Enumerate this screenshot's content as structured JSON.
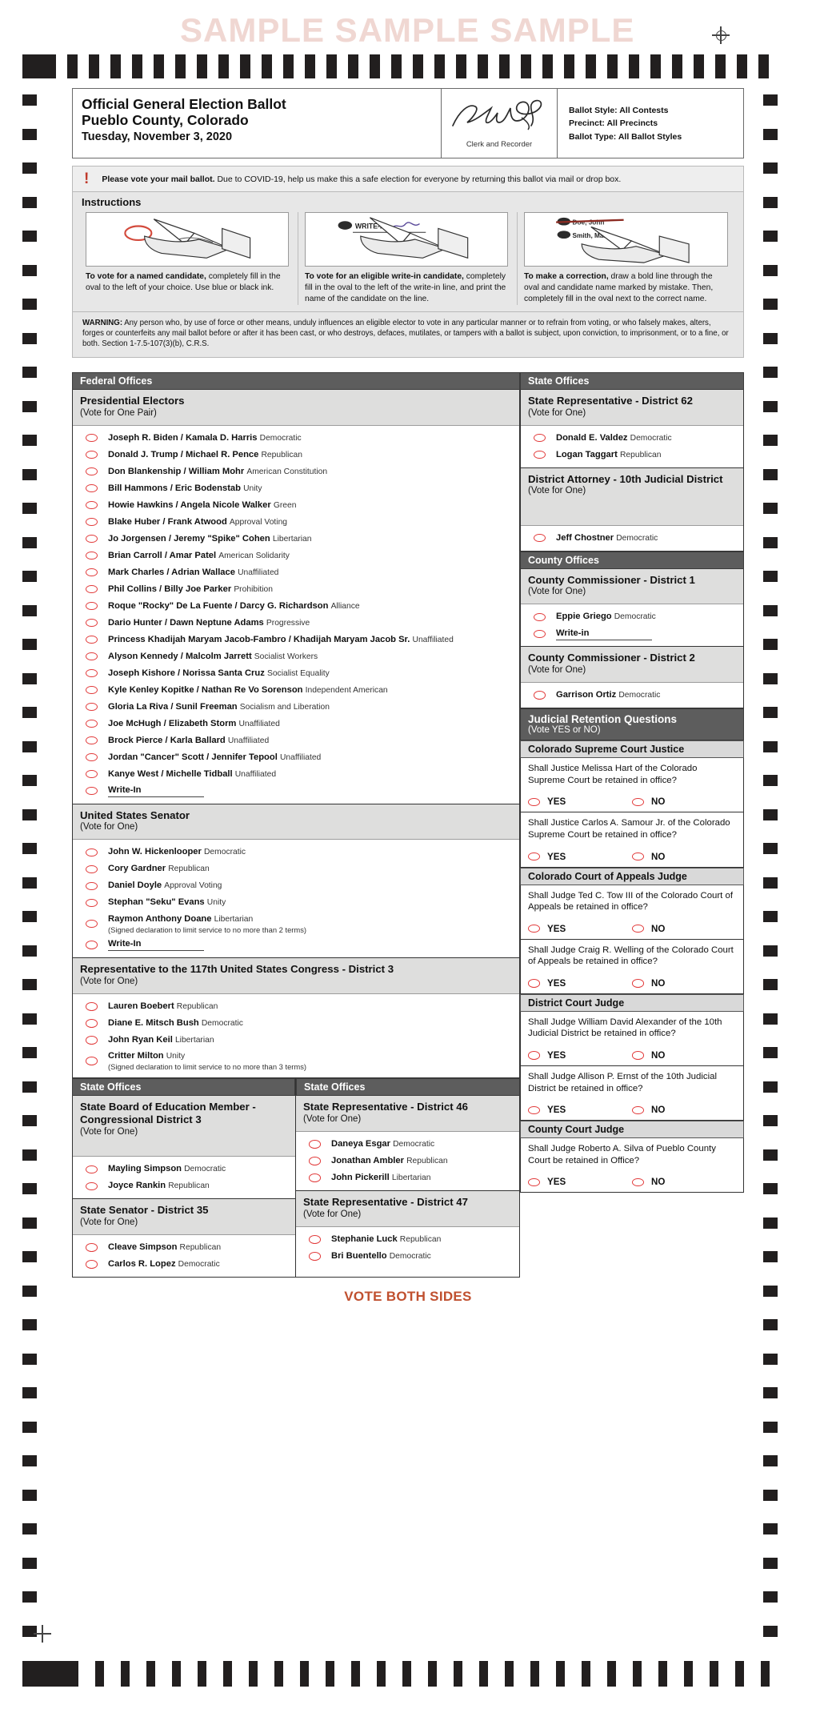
{
  "watermark": "SAMPLE SAMPLE SAMPLE",
  "header": {
    "title_line1": "Official General Election Ballot",
    "title_line2": "Pueblo County, Colorado",
    "title_line3": "Tuesday, November 3, 2020",
    "signature_caption": "Clerk and Recorder",
    "ballot_style": "Ballot Style: All Contests",
    "precinct": "Precinct: All Precincts",
    "ballot_type": "Ballot Type: All Ballot Styles"
  },
  "notice": {
    "bold": "Please vote your mail ballot.",
    "rest": " Due to COVID-19, help us make this a safe election for everyone by returning this ballot via mail or drop box.",
    "icon": "exclamation-icon"
  },
  "instructions": {
    "heading": "Instructions",
    "items": [
      {
        "bold": "To vote for a named candidate,",
        "rest": " completely fill in the oval to the left of your choice. Use blue or black ink.",
        "image_name": "fill-oval-illustration"
      },
      {
        "bold": "To vote for an eligible write-in candidate,",
        "rest": " completely fill in the oval to the left of the write-in line, and print the name of the candidate on the line.",
        "image_name": "write-in-illustration",
        "image_label": "WRITE-IN"
      },
      {
        "bold": "To make a correction,",
        "rest": " draw a bold line through the oval and candidate name marked by mistake. Then, completely fill in the oval next to the correct name.",
        "image_name": "correction-illustration",
        "image_label_1": "Doe, John",
        "image_label_2": "Smith, Mary"
      }
    ]
  },
  "warning": {
    "bold": "WARNING:",
    "rest": " Any person who, by use of force or other means, unduly influences an eligible elector to vote in any particular manner or to refrain from voting, or who falsely makes, alters, forges or counterfeits any mail ballot before or after it has been cast, or who destroys, defaces, mutilates, or tampers with a ballot is subject, upon conviction, to imprisonment, or to a fine, or both. Section 1-7.5-107(3)(b), C.R.S."
  },
  "bands": {
    "federal_offices": "Federal Offices",
    "state_offices": "State Offices",
    "county_offices": "County Offices",
    "judicial_retention": "Judicial Retention Questions",
    "judicial_retention_sub": "(Vote YES or NO)",
    "colorado_supreme_court_justice": "Colorado Supreme Court Justice",
    "colorado_court_of_appeals_judge": "Colorado Court of Appeals Judge",
    "district_court_judge": "District Court Judge",
    "county_court_judge": "County Court Judge"
  },
  "labels": {
    "write_in": "Write-In",
    "write_in_lc": "Write-in",
    "yes": "YES",
    "no": "NO"
  },
  "contests": {
    "presidential_electors": {
      "title": "Presidential Electors",
      "sub": "(Vote for One Pair)",
      "options": [
        {
          "name": "Joseph R. Biden / Kamala D. Harris",
          "party": "Democratic"
        },
        {
          "name": "Donald J. Trump / Michael R. Pence",
          "party": "Republican"
        },
        {
          "name": "Don Blankenship / William Mohr",
          "party": "American Constitution"
        },
        {
          "name": "Bill Hammons / Eric Bodenstab",
          "party": "Unity"
        },
        {
          "name": "Howie Hawkins / Angela Nicole Walker",
          "party": "Green"
        },
        {
          "name": "Blake Huber / Frank Atwood",
          "party": "Approval Voting"
        },
        {
          "name": "Jo Jorgensen / Jeremy \"Spike\" Cohen",
          "party": "Libertarian"
        },
        {
          "name": "Brian Carroll / Amar Patel",
          "party": "American Solidarity"
        },
        {
          "name": "Mark Charles / Adrian Wallace",
          "party": "Unaffiliated"
        },
        {
          "name": "Phil Collins / Billy Joe Parker",
          "party": "Prohibition"
        },
        {
          "name": "Roque \"Rocky\" De La Fuente / Darcy G. Richardson",
          "party": "Alliance"
        },
        {
          "name": "Dario Hunter / Dawn Neptune Adams",
          "party": "Progressive"
        },
        {
          "name": "Princess Khadijah Maryam Jacob-Fambro / Khadijah Maryam Jacob Sr.",
          "party": "Unaffiliated"
        },
        {
          "name": "Alyson Kennedy / Malcolm Jarrett",
          "party": "Socialist Workers"
        },
        {
          "name": "Joseph Kishore / Norissa Santa Cruz",
          "party": "Socialist Equality"
        },
        {
          "name": "Kyle Kenley Kopitke / Nathan Re Vo Sorenson",
          "party": "Independent American"
        },
        {
          "name": "Gloria La Riva / Sunil Freeman",
          "party": "Socialism and Liberation"
        },
        {
          "name": "Joe McHugh / Elizabeth Storm",
          "party": "Unaffiliated"
        },
        {
          "name": "Brock Pierce / Karla Ballard",
          "party": "Unaffiliated"
        },
        {
          "name": "Jordan \"Cancer\" Scott / Jennifer Tepool",
          "party": "Unaffiliated"
        },
        {
          "name": "Kanye West / Michelle Tidball",
          "party": "Unaffiliated"
        },
        {
          "name": "Write-In",
          "party": "",
          "writein": true
        }
      ]
    },
    "us_senator": {
      "title": "United States Senator",
      "sub": "(Vote for One)",
      "options": [
        {
          "name": "John W. Hickenlooper",
          "party": "Democratic"
        },
        {
          "name": "Cory Gardner",
          "party": "Republican"
        },
        {
          "name": "Daniel Doyle",
          "party": "Approval Voting"
        },
        {
          "name": "Stephan \"Seku\" Evans",
          "party": "Unity"
        },
        {
          "name": "Raymon Anthony Doane",
          "party": "Libertarian",
          "note": "(Signed declaration to limit service to no more than 2 terms)"
        },
        {
          "name": "Write-In",
          "party": "",
          "writein": true
        }
      ]
    },
    "us_rep_d3": {
      "title": "Representative to the 117th United States Congress - District 3",
      "sub": "(Vote for One)",
      "options": [
        {
          "name": "Lauren Boebert",
          "party": "Republican"
        },
        {
          "name": "Diane E. Mitsch Bush",
          "party": "Democratic"
        },
        {
          "name": "John Ryan Keil",
          "party": "Libertarian"
        },
        {
          "name": "Critter Milton",
          "party": "Unity",
          "note": "(Signed declaration to limit service to no more than 3 terms)"
        }
      ]
    },
    "state_board_edu_cd3": {
      "title": "State Board of Education Member - Congressional District 3",
      "sub": "(Vote for One)",
      "options": [
        {
          "name": "Mayling Simpson",
          "party": "Democratic"
        },
        {
          "name": "Joyce Rankin",
          "party": "Republican"
        }
      ]
    },
    "state_senator_d35": {
      "title": "State Senator - District 35",
      "sub": "(Vote for One)",
      "options": [
        {
          "name": "Cleave Simpson",
          "party": "Republican"
        },
        {
          "name": "Carlos R. Lopez",
          "party": "Democratic"
        }
      ]
    },
    "state_rep_d46": {
      "title": "State Representative - District 46",
      "sub": "(Vote for One)",
      "options": [
        {
          "name": "Daneya Esgar",
          "party": "Democratic"
        },
        {
          "name": "Jonathan Ambler",
          "party": "Republican"
        },
        {
          "name": "John Pickerill",
          "party": "Libertarian"
        }
      ]
    },
    "state_rep_d47": {
      "title": "State Representative - District 47",
      "sub": "(Vote for One)",
      "options": [
        {
          "name": "Stephanie Luck",
          "party": "Republican"
        },
        {
          "name": "Bri Buentello",
          "party": "Democratic"
        }
      ]
    },
    "state_rep_d62": {
      "title": "State Representative - District 62",
      "sub": "(Vote for One)",
      "options": [
        {
          "name": "Donald E. Valdez",
          "party": "Democratic"
        },
        {
          "name": "Logan Taggart",
          "party": "Republican"
        }
      ]
    },
    "district_attorney_10th": {
      "title": "District Attorney - 10th Judicial District",
      "sub": "(Vote for One)",
      "options": [
        {
          "name": "Jeff Chostner",
          "party": "Democratic"
        }
      ]
    },
    "county_commissioner_d1": {
      "title": "County Commissioner - District 1",
      "sub": "(Vote for One)",
      "options": [
        {
          "name": "Eppie Griego",
          "party": "Democratic"
        },
        {
          "name": "Write-in",
          "party": "",
          "writein": true
        }
      ]
    },
    "county_commissioner_d2": {
      "title": "County Commissioner - District 2",
      "sub": "(Vote for One)",
      "options": [
        {
          "name": "Garrison Ortiz",
          "party": "Democratic"
        }
      ]
    }
  },
  "retention_questions": {
    "supreme_court": [
      {
        "question": "Shall Justice Melissa Hart of the Colorado Supreme Court be retained in office?"
      },
      {
        "question": "Shall Justice Carlos A. Samour Jr. of the Colorado Supreme Court be retained in office?"
      }
    ],
    "court_of_appeals": [
      {
        "question": "Shall Judge Ted C. Tow III of the Colorado Court of Appeals be retained in office?"
      },
      {
        "question": "Shall Judge Craig R. Welling of the Colorado Court of Appeals be retained in office?"
      }
    ],
    "district_court": [
      {
        "question": "Shall Judge William David Alexander of the 10th Judicial District be retained in office?"
      },
      {
        "question": "Shall Judge Allison P. Ernst of the 10th Judicial District be retained in office?"
      }
    ],
    "county_court": [
      {
        "question": "Shall Judge Roberto A. Silva of Pueblo County Court be retained in Office?"
      }
    ]
  },
  "footer": {
    "text": "VOTE BOTH SIDES"
  },
  "colors": {
    "oval": "#e23b3b",
    "band": "#5d5d5d",
    "footer": "#c0502f",
    "watermark": "#f0d7d2"
  }
}
